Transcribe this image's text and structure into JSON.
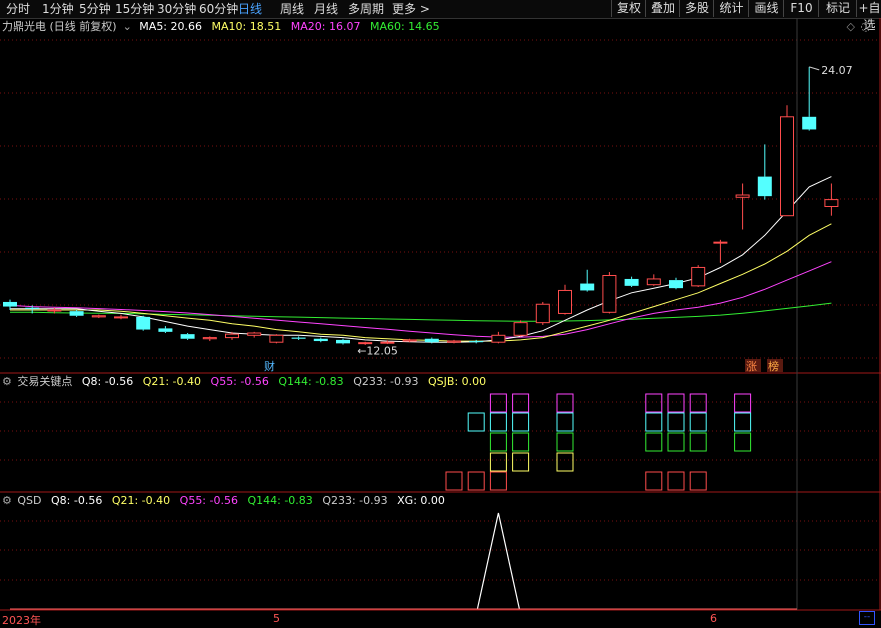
{
  "toolbar": {
    "periods": [
      "分时",
      "1分钟",
      "5分钟",
      "15分钟",
      "30分钟",
      "60分钟",
      "日线",
      "周线",
      "月线",
      "多周期",
      "更多 >"
    ],
    "active": "日线",
    "buttons": [
      "复权",
      "叠加",
      "多股",
      "统计",
      "画线",
      "F10",
      "标记",
      "+自选"
    ]
  },
  "main_legend": {
    "title": "力鼎光电 (日线 前复权)",
    "ma5": "MA5: 20.66",
    "ma10": "MA10: 18.51",
    "ma20": "MA20: 16.07",
    "ma60": "MA60: 14.65"
  },
  "indicator1_legend": {
    "name": "交易关键点",
    "q8": "Q8: -0.56",
    "q21": "Q21: -0.40",
    "q55": "Q55: -0.56",
    "q144": "Q144: -0.83",
    "q233": "Q233: -0.93",
    "qsjb": "QSJB: 0.00"
  },
  "indicator2_legend": {
    "name": "QSD",
    "q8": "Q8: -0.56",
    "q21": "Q21: -0.40",
    "q55": "Q55: -0.56",
    "q144": "Q144: -0.83",
    "q233": "Q233: -0.93",
    "xg": "XG: 0.00"
  },
  "annotations": {
    "high_price": "24.07",
    "low_price": "12.05",
    "low_arrow": "←",
    "cai_badge": "财",
    "zhang_badge": "涨",
    "bang_badge": "榜"
  },
  "time_axis": {
    "year": "2023年",
    "m5": "5",
    "m6": "6"
  },
  "colors": {
    "up": "#ff4d4d",
    "down": "#54ffff",
    "ma5": "#ffffff",
    "ma10": "#ffff66",
    "ma20": "#ff44ff",
    "ma60": "#33ee33",
    "grid": "#7a1010"
  },
  "chart_data": {
    "type": "candlestick",
    "ylim": [
      11.5,
      25.5
    ],
    "candles": [
      {
        "o": 13.85,
        "c": 13.65,
        "h": 13.95,
        "l": 13.5
      },
      {
        "o": 13.6,
        "c": 13.55,
        "h": 13.7,
        "l": 13.35
      },
      {
        "o": 13.5,
        "c": 13.5,
        "h": 13.6,
        "l": 13.35
      },
      {
        "o": 13.45,
        "c": 13.25,
        "h": 13.5,
        "l": 13.2
      },
      {
        "o": 13.2,
        "c": 13.25,
        "h": 13.3,
        "l": 13.15
      },
      {
        "o": 13.2,
        "c": 13.2,
        "h": 13.3,
        "l": 13.1
      },
      {
        "o": 13.2,
        "c": 12.65,
        "h": 13.25,
        "l": 12.6
      },
      {
        "o": 12.7,
        "c": 12.55,
        "h": 12.8,
        "l": 12.5
      },
      {
        "o": 12.45,
        "c": 12.25,
        "h": 12.5,
        "l": 12.2
      },
      {
        "o": 12.25,
        "c": 12.3,
        "h": 12.35,
        "l": 12.15
      },
      {
        "o": 12.3,
        "c": 12.45,
        "h": 12.55,
        "l": 12.2
      },
      {
        "o": 12.4,
        "c": 12.5,
        "h": 12.55,
        "l": 12.3
      },
      {
        "o": 12.1,
        "c": 12.4,
        "h": 12.45,
        "l": 12.05
      },
      {
        "o": 12.3,
        "c": 12.25,
        "h": 12.35,
        "l": 12.2
      },
      {
        "o": 12.25,
        "c": 12.15,
        "h": 12.3,
        "l": 12.1
      },
      {
        "o": 12.2,
        "c": 12.05,
        "h": 12.25,
        "l": 12.0
      },
      {
        "o": 12.05,
        "c": 12.08,
        "h": 12.12,
        "l": 11.98
      },
      {
        "o": 12.1,
        "c": 12.1,
        "h": 12.18,
        "l": 12.02
      },
      {
        "o": 12.15,
        "c": 12.2,
        "h": 12.25,
        "l": 12.1
      },
      {
        "o": 12.25,
        "c": 12.1,
        "h": 12.3,
        "l": 12.05
      },
      {
        "o": 12.1,
        "c": 12.15,
        "h": 12.2,
        "l": 12.05
      },
      {
        "o": 12.15,
        "c": 12.1,
        "h": 12.2,
        "l": 12.05
      },
      {
        "o": 12.1,
        "c": 12.4,
        "h": 12.55,
        "l": 12.05
      },
      {
        "o": 12.4,
        "c": 12.95,
        "h": 13.05,
        "l": 12.35
      },
      {
        "o": 12.95,
        "c": 13.75,
        "h": 13.85,
        "l": 12.85
      },
      {
        "o": 13.35,
        "c": 14.35,
        "h": 14.6,
        "l": 13.3
      },
      {
        "o": 14.65,
        "c": 14.35,
        "h": 15.25,
        "l": 14.3
      },
      {
        "o": 13.4,
        "c": 15.0,
        "h": 15.15,
        "l": 13.35
      },
      {
        "o": 14.85,
        "c": 14.55,
        "h": 14.95,
        "l": 14.5
      },
      {
        "o": 14.6,
        "c": 14.85,
        "h": 15.05,
        "l": 14.55
      },
      {
        "o": 14.8,
        "c": 14.45,
        "h": 14.9,
        "l": 14.4
      },
      {
        "o": 14.55,
        "c": 15.35,
        "h": 15.45,
        "l": 14.5
      },
      {
        "o": 16.45,
        "c": 16.45,
        "h": 16.55,
        "l": 15.55
      },
      {
        "o": 18.4,
        "c": 18.5,
        "h": 19.0,
        "l": 17.0
      },
      {
        "o": 19.3,
        "c": 18.45,
        "h": 20.7,
        "l": 18.3
      },
      {
        "o": 17.6,
        "c": 21.9,
        "h": 22.4,
        "l": 17.6
      },
      {
        "o": 21.9,
        "c": 21.35,
        "h": 24.07,
        "l": 21.3
      },
      {
        "o": 18.0,
        "c": 18.3,
        "h": 19.0,
        "l": 17.6
      }
    ],
    "ma5": [
      13.55,
      13.55,
      13.55,
      13.55,
      13.45,
      13.35,
      13.2,
      13.0,
      12.8,
      12.65,
      12.5,
      12.45,
      12.4,
      12.4,
      12.35,
      12.3,
      12.2,
      12.15,
      12.12,
      12.1,
      12.1,
      12.12,
      12.2,
      12.35,
      12.6,
      13.05,
      13.5,
      13.9,
      14.25,
      14.45,
      14.65,
      14.9,
      15.35,
      15.9,
      16.75,
      17.8,
      18.85,
      19.3
    ],
    "ma10": [
      13.5,
      13.5,
      13.5,
      13.5,
      13.5,
      13.45,
      13.35,
      13.25,
      13.15,
      13.05,
      12.9,
      12.8,
      12.65,
      12.55,
      12.45,
      12.4,
      12.3,
      12.25,
      12.2,
      12.18,
      12.15,
      12.15,
      12.15,
      12.2,
      12.3,
      12.55,
      12.8,
      13.05,
      13.35,
      13.65,
      13.95,
      14.25,
      14.65,
      15.05,
      15.5,
      16.05,
      16.75,
      17.25
    ],
    "ma20": [
      13.7,
      13.65,
      13.62,
      13.6,
      13.56,
      13.52,
      13.48,
      13.43,
      13.37,
      13.3,
      13.22,
      13.14,
      13.06,
      12.98,
      12.9,
      12.82,
      12.74,
      12.66,
      12.58,
      12.5,
      12.42,
      12.36,
      12.32,
      12.32,
      12.35,
      12.45,
      12.65,
      12.9,
      13.15,
      13.35,
      13.5,
      13.62,
      13.8,
      14.05,
      14.4,
      14.8,
      15.2,
      15.6
    ],
    "ma60": [
      13.4,
      13.4,
      13.38,
      13.37,
      13.36,
      13.35,
      13.33,
      13.31,
      13.29,
      13.27,
      13.25,
      13.23,
      13.21,
      13.19,
      13.17,
      13.15,
      13.13,
      13.11,
      13.09,
      13.07,
      13.05,
      13.03,
      13.02,
      13.01,
      13.01,
      13.02,
      13.04,
      13.07,
      13.1,
      13.14,
      13.18,
      13.22,
      13.28,
      13.36,
      13.46,
      13.57,
      13.68,
      13.8
    ],
    "markers": [
      {
        "i": 20,
        "levels": [
          1
        ]
      },
      {
        "i": 21,
        "levels": [
          1,
          4
        ]
      },
      {
        "i": 22,
        "levels": [
          1,
          2,
          3,
          4,
          5
        ]
      },
      {
        "i": 23,
        "levels": [
          2,
          3,
          4,
          5
        ]
      },
      {
        "i": 25,
        "levels": [
          2,
          3,
          4,
          5
        ]
      },
      {
        "i": 29,
        "levels": [
          1,
          3,
          4,
          5
        ]
      },
      {
        "i": 30,
        "levels": [
          1,
          3,
          4,
          5
        ]
      },
      {
        "i": 31,
        "levels": [
          1,
          3,
          4,
          5
        ]
      },
      {
        "i": 33,
        "levels": [
          3,
          4,
          5
        ]
      }
    ],
    "signal_index": 22
  }
}
